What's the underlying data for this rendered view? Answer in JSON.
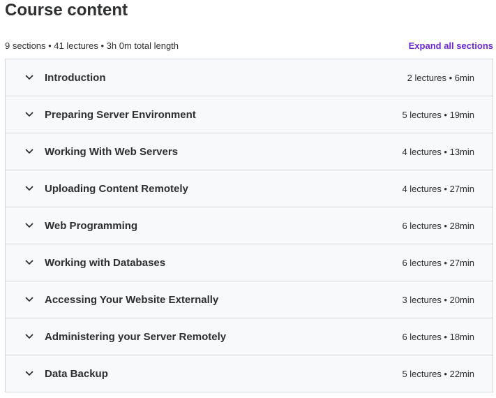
{
  "header": {
    "title": "Course content",
    "summary": "9 sections • 41 lectures • 3h 0m total length",
    "expand_label": "Expand all sections"
  },
  "colors": {
    "accent": "#6d28d2",
    "text": "#2d2f31",
    "section_bg": "#f7f9fa",
    "border": "#d1d7dc"
  },
  "sections": [
    {
      "title": "Introduction",
      "meta": "2 lectures • 6min",
      "icon": "chevron-down-icon"
    },
    {
      "title": "Preparing Server Environment",
      "meta": "5 lectures • 19min",
      "icon": "chevron-down-icon"
    },
    {
      "title": "Working With Web Servers",
      "meta": "4 lectures • 13min",
      "icon": "chevron-down-icon"
    },
    {
      "title": "Uploading Content Remotely",
      "meta": "4 lectures • 27min",
      "icon": "chevron-down-icon"
    },
    {
      "title": "Web Programming",
      "meta": "6 lectures • 28min",
      "icon": "chevron-down-icon"
    },
    {
      "title": "Working with Databases",
      "meta": "6 lectures • 27min",
      "icon": "chevron-down-icon"
    },
    {
      "title": "Accessing Your Website Externally",
      "meta": "3 lectures • 20min",
      "icon": "chevron-down-icon"
    },
    {
      "title": "Administering your Server Remotely",
      "meta": "6 lectures • 18min",
      "icon": "chevron-down-icon"
    },
    {
      "title": "Data Backup",
      "meta": "5 lectures • 22min",
      "icon": "chevron-down-icon"
    }
  ]
}
